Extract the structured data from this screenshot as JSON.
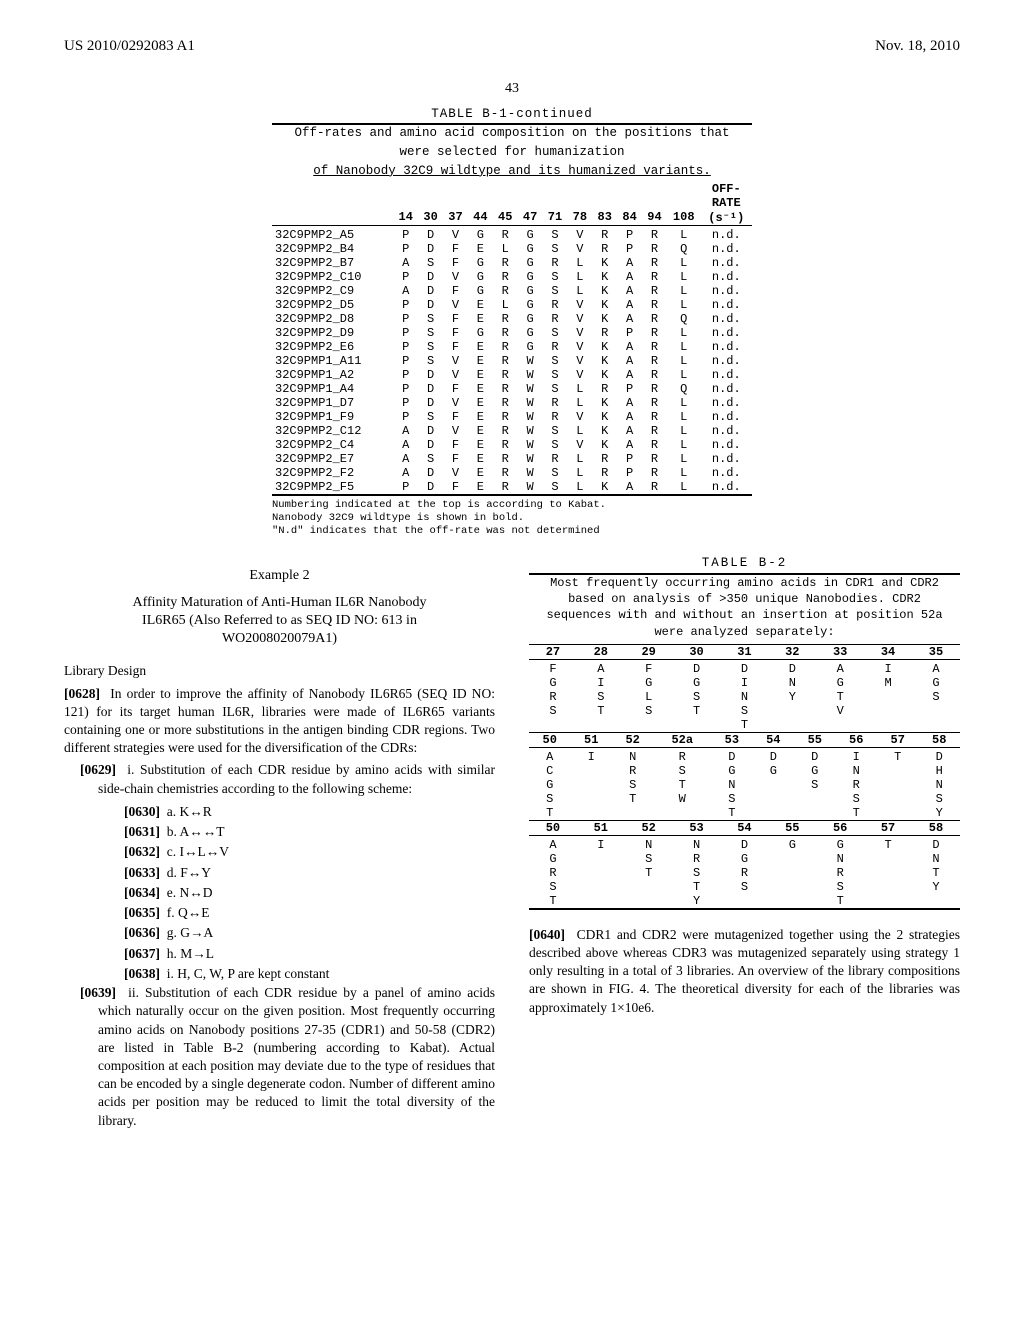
{
  "header": {
    "pub_number": "US 2010/0292083 A1",
    "date": "Nov. 18, 2010",
    "page": "43"
  },
  "tableB1": {
    "title": "TABLE B-1-continued",
    "caption_l1": "Off-rates and amino acid composition on the positions that",
    "caption_l2": "were selected for humanization",
    "caption_l3": "of Nanobody 32C9 wildtype and its humanized variants.",
    "headers": [
      "14",
      "30",
      "37",
      "44",
      "45",
      "47",
      "71",
      "78",
      "83",
      "84",
      "94",
      "108"
    ],
    "rate_head1": "OFF-",
    "rate_head2": "RATE",
    "rate_unit": "(s⁻¹)",
    "rows": [
      {
        "name": "32C9PMP2_A5",
        "aa": [
          "P",
          "D",
          "V",
          "G",
          "R",
          "G",
          "S",
          "V",
          "R",
          "P",
          "R",
          "L"
        ],
        "off": "n.d."
      },
      {
        "name": "32C9PMP2_B4",
        "aa": [
          "P",
          "D",
          "F",
          "E",
          "L",
          "G",
          "S",
          "V",
          "R",
          "P",
          "R",
          "Q"
        ],
        "off": "n.d."
      },
      {
        "name": "32C9PMP2_B7",
        "aa": [
          "A",
          "S",
          "F",
          "G",
          "R",
          "G",
          "R",
          "L",
          "K",
          "A",
          "R",
          "L"
        ],
        "off": "n.d."
      },
      {
        "name": "32C9PMP2_C10",
        "aa": [
          "P",
          "D",
          "V",
          "G",
          "R",
          "G",
          "S",
          "L",
          "K",
          "A",
          "R",
          "L"
        ],
        "off": "n.d."
      },
      {
        "name": "32C9PMP2_C9",
        "aa": [
          "A",
          "D",
          "F",
          "G",
          "R",
          "G",
          "S",
          "L",
          "K",
          "A",
          "R",
          "L"
        ],
        "off": "n.d."
      },
      {
        "name": "32C9PMP2_D5",
        "aa": [
          "P",
          "D",
          "V",
          "E",
          "L",
          "G",
          "R",
          "V",
          "K",
          "A",
          "R",
          "L"
        ],
        "off": "n.d."
      },
      {
        "name": "32C9PMP2_D8",
        "aa": [
          "P",
          "S",
          "F",
          "E",
          "R",
          "G",
          "R",
          "V",
          "K",
          "A",
          "R",
          "Q"
        ],
        "off": "n.d."
      },
      {
        "name": "32C9PMP2_D9",
        "aa": [
          "P",
          "S",
          "F",
          "G",
          "R",
          "G",
          "S",
          "V",
          "R",
          "P",
          "R",
          "L"
        ],
        "off": "n.d."
      },
      {
        "name": "32C9PMP2_E6",
        "aa": [
          "P",
          "S",
          "F",
          "E",
          "R",
          "G",
          "R",
          "V",
          "K",
          "A",
          "R",
          "L"
        ],
        "off": "n.d."
      },
      {
        "name": "32C9PMP1_A11",
        "aa": [
          "P",
          "S",
          "V",
          "E",
          "R",
          "W",
          "S",
          "V",
          "K",
          "A",
          "R",
          "L"
        ],
        "off": "n.d."
      },
      {
        "name": "32C9PMP1_A2",
        "aa": [
          "P",
          "D",
          "V",
          "E",
          "R",
          "W",
          "S",
          "V",
          "K",
          "A",
          "R",
          "L"
        ],
        "off": "n.d."
      },
      {
        "name": "32C9PMP1_A4",
        "aa": [
          "P",
          "D",
          "F",
          "E",
          "R",
          "W",
          "S",
          "L",
          "R",
          "P",
          "R",
          "Q"
        ],
        "off": "n.d."
      },
      {
        "name": "32C9PMP1_D7",
        "aa": [
          "P",
          "D",
          "V",
          "E",
          "R",
          "W",
          "R",
          "L",
          "K",
          "A",
          "R",
          "L"
        ],
        "off": "n.d."
      },
      {
        "name": "32C9PMP1_F9",
        "aa": [
          "P",
          "S",
          "F",
          "E",
          "R",
          "W",
          "R",
          "V",
          "K",
          "A",
          "R",
          "L"
        ],
        "off": "n.d."
      },
      {
        "name": "32C9PMP2_C12",
        "aa": [
          "A",
          "D",
          "V",
          "E",
          "R",
          "W",
          "S",
          "L",
          "K",
          "A",
          "R",
          "L"
        ],
        "off": "n.d."
      },
      {
        "name": "32C9PMP2_C4",
        "aa": [
          "A",
          "D",
          "F",
          "E",
          "R",
          "W",
          "S",
          "V",
          "K",
          "A",
          "R",
          "L"
        ],
        "off": "n.d."
      },
      {
        "name": "32C9PMP2_E7",
        "aa": [
          "A",
          "S",
          "F",
          "E",
          "R",
          "W",
          "R",
          "L",
          "R",
          "P",
          "R",
          "L"
        ],
        "off": "n.d."
      },
      {
        "name": "32C9PMP2_F2",
        "aa": [
          "A",
          "D",
          "V",
          "E",
          "R",
          "W",
          "S",
          "L",
          "R",
          "P",
          "R",
          "L"
        ],
        "off": "n.d."
      },
      {
        "name": "32C9PMP2_F5",
        "aa": [
          "P",
          "D",
          "F",
          "E",
          "R",
          "W",
          "S",
          "L",
          "K",
          "A",
          "R",
          "L"
        ],
        "off": "n.d."
      }
    ],
    "footnote1": "Numbering indicated at the top is according to Kabat.",
    "footnote2": "Nanobody 32C9 wildtype is shown in bold.",
    "footnote3": "\"N.d\" indicates that the off-rate was not determined"
  },
  "left": {
    "example_label": "Example 2",
    "example_title_l1": "Affinity Maturation of Anti-Human IL6R Nanobody",
    "example_title_l2": "IL6R65 (Also Referred to as SEQ ID NO: 613 in",
    "example_title_l3": "WO2008020079A1)",
    "library_design": "Library Design",
    "para0628_num": "[0628]",
    "para0628": "In order to improve the affinity of Nanobody IL6R65 (SEQ ID NO: 121) for its target human IL6R, libraries were made of IL6R65 variants containing one or more substitutions in the antigen binding CDR regions. Two different strategies were used for the diversification of the CDRs:",
    "para0629_num": "[0629]",
    "para0629": "i. Substitution of each CDR residue by amino acids with similar side-chain chemistries according to the following scheme:",
    "scheme": [
      {
        "num": "[0630]",
        "txt": "a. K↔R"
      },
      {
        "num": "[0631]",
        "txt": "b. A↔↔T"
      },
      {
        "num": "[0632]",
        "txt": "c. I↔L↔V"
      },
      {
        "num": "[0633]",
        "txt": "d. F↔Y"
      },
      {
        "num": "[0634]",
        "txt": "e. N↔D"
      },
      {
        "num": "[0635]",
        "txt": "f. Q↔E"
      },
      {
        "num": "[0636]",
        "txt": "g. G→A"
      },
      {
        "num": "[0637]",
        "txt": "h. M→L"
      },
      {
        "num": "[0638]",
        "txt": "i. H, C, W, P are kept constant"
      }
    ],
    "para0639_num": "[0639]",
    "para0639": "ii. Substitution of each CDR residue by a panel of amino acids which naturally occur on the given position. Most frequently occurring amino acids on Nanobody positions 27-35 (CDR1) and 50-58 (CDR2) are listed in Table B-2 (numbering according to Kabat). Actual composition at each position may deviate due to the type of residues that can be encoded by a single degenerate codon. Number of different amino acids per position may be reduced to limit the total diversity of the library."
  },
  "tableB2": {
    "title": "TABLE B-2",
    "caption": "Most frequently occurring amino acids in CDR1 and CDR2 based on analysis of >350 unique Nanobodies. CDR2 sequences with and without an insertion at position 52a were analyzed separately:",
    "block1_head": [
      "27",
      "28",
      "29",
      "30",
      "31",
      "32",
      "33",
      "34",
      "35"
    ],
    "block1_rows": [
      [
        "F",
        "A",
        "F",
        "D",
        "D",
        "D",
        "A",
        "I",
        "A"
      ],
      [
        "G",
        "I",
        "G",
        "G",
        "I",
        "N",
        "G",
        "M",
        "G"
      ],
      [
        "R",
        "S",
        "L",
        "S",
        "N",
        "Y",
        "T",
        "",
        "S"
      ],
      [
        "S",
        "T",
        "S",
        "T",
        "S",
        "",
        "V",
        "",
        ""
      ],
      [
        "",
        "",
        "",
        "",
        "T",
        "",
        "",
        "",
        ""
      ]
    ],
    "block2_head": [
      "50",
      "51",
      "52",
      "52a",
      "53",
      "54",
      "55",
      "56",
      "57",
      "58"
    ],
    "block2_rows": [
      [
        "A",
        "I",
        "N",
        "R",
        "D",
        "D",
        "D",
        "I",
        "T",
        "D"
      ],
      [
        "C",
        "",
        "R",
        "S",
        "G",
        "G",
        "G",
        "N",
        "",
        "H"
      ],
      [
        "G",
        "",
        "S",
        "T",
        "N",
        "",
        "S",
        "R",
        "",
        "N"
      ],
      [
        "S",
        "",
        "T",
        "W",
        "S",
        "",
        "",
        "S",
        "",
        "S"
      ],
      [
        "T",
        "",
        "",
        "",
        "T",
        "",
        "",
        "T",
        "",
        "Y"
      ]
    ],
    "block3_head": [
      "50",
      "51",
      "52",
      "53",
      "54",
      "55",
      "56",
      "57",
      "58"
    ],
    "block3_rows": [
      [
        "A",
        "I",
        "N",
        "N",
        "D",
        "G",
        "G",
        "T",
        "D"
      ],
      [
        "G",
        "",
        "S",
        "R",
        "G",
        "",
        "N",
        "",
        "N"
      ],
      [
        "R",
        "",
        "T",
        "S",
        "R",
        "",
        "R",
        "",
        "T"
      ],
      [
        "S",
        "",
        "",
        "T",
        "S",
        "",
        "S",
        "",
        "Y"
      ],
      [
        "T",
        "",
        "",
        "Y",
        "",
        "",
        "T",
        "",
        ""
      ]
    ]
  },
  "right": {
    "para0640_num": "[0640]",
    "para0640": "CDR1 and CDR2 were mutagenized together using the 2 strategies described above whereas CDR3 was mutagenized separately using strategy 1 only resulting in a total of 3 libraries. An overview of the library compositions are shown in FIG. 4. The theoretical diversity for each of the libraries was approximately 1×10e6."
  }
}
